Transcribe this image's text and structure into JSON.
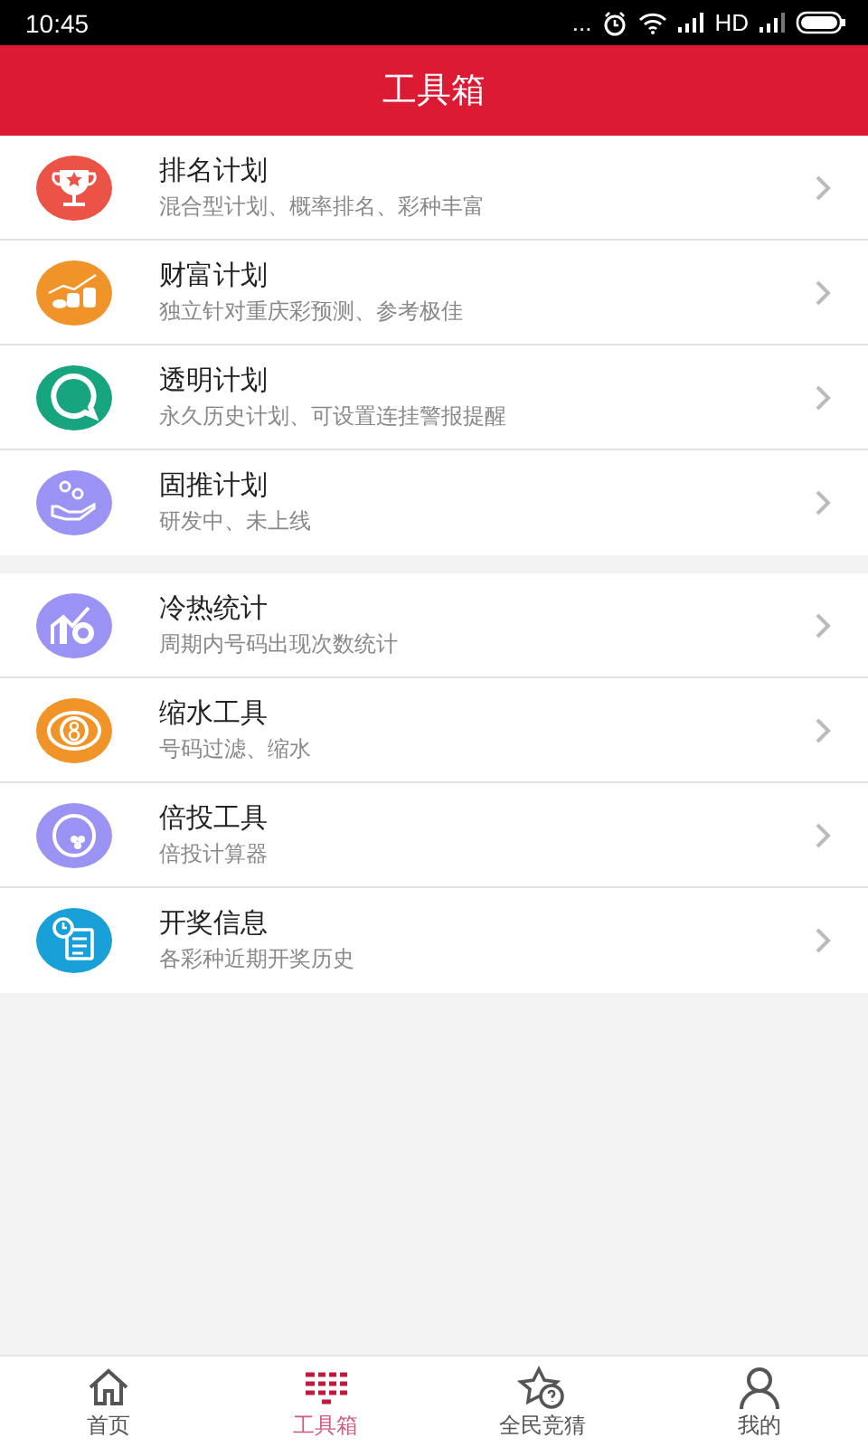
{
  "status_bar": {
    "time": "10:45",
    "more": "...",
    "network": "HD"
  },
  "header": {
    "title": "工具箱"
  },
  "groups": [
    {
      "items": [
        {
          "title": "排名计划",
          "subtitle": "混合型计划、概率排名、彩种丰富",
          "kind": "trophy",
          "color": "#ea5346"
        },
        {
          "title": "财富计划",
          "subtitle": "独立针对重庆彩预测、参考极佳",
          "kind": "coins",
          "color": "#f0942a"
        },
        {
          "title": "透明计划",
          "subtitle": "永久历史计划、可设置连挂警报提醒",
          "kind": "bubble",
          "color": "#17a57f"
        },
        {
          "title": "固推计划",
          "subtitle": "研发中、未上线",
          "kind": "hand",
          "color": "#9b93f3"
        }
      ]
    },
    {
      "items": [
        {
          "title": "冷热统计",
          "subtitle": "周期内号码出现次数统计",
          "kind": "chart",
          "color": "#9b93f3"
        },
        {
          "title": "缩水工具",
          "subtitle": "号码过滤、缩水",
          "kind": "ball",
          "color": "#f0942a"
        },
        {
          "title": "倍投工具",
          "subtitle": "倍投计算器",
          "kind": "bowl",
          "color": "#9b93f3"
        },
        {
          "title": "开奖信息",
          "subtitle": "各彩种近期开奖历史",
          "kind": "clock",
          "color": "#1aa0d8"
        }
      ]
    }
  ],
  "tabs": [
    {
      "label": "首页",
      "kind": "home",
      "selected": false
    },
    {
      "label": "工具箱",
      "kind": "toolbox",
      "selected": true
    },
    {
      "label": "全民竞猜",
      "kind": "star",
      "selected": false
    },
    {
      "label": "我的",
      "kind": "person",
      "selected": false
    }
  ]
}
